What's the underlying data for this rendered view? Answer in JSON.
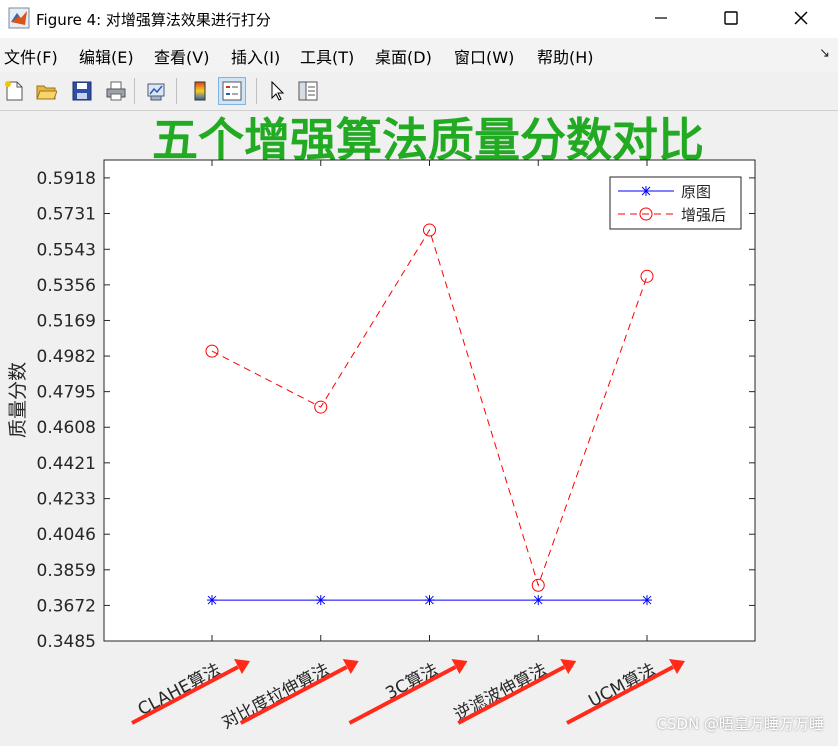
{
  "window": {
    "title": "Figure 4: 对增强算法效果进行打分",
    "minimize_icon": "minimize-icon",
    "maximize_icon": "maximize-icon",
    "close_icon": "close-icon"
  },
  "menu": [
    {
      "label": "文件(F)"
    },
    {
      "label": "编辑(E)"
    },
    {
      "label": "查看(V)"
    },
    {
      "label": "插入(I)"
    },
    {
      "label": "工具(T)"
    },
    {
      "label": "桌面(D)"
    },
    {
      "label": "窗口(W)"
    },
    {
      "label": "帮助(H)"
    }
  ],
  "toolbar": {
    "icons": [
      "new-file-icon",
      "open-folder-icon",
      "save-icon",
      "print-icon",
      "link-icon",
      "colorbar-icon",
      "legend-icon",
      "pointer-icon",
      "property-editor-icon"
    ]
  },
  "chart_data": {
    "type": "line",
    "title": "五个增强算法质量分数对比",
    "xlabel": "",
    "ylabel": "质量分数",
    "categories": [
      "CLAHE算法",
      "对比度拉伸算法",
      "3C算法",
      "逆滤波伸算法",
      "UCM算法"
    ],
    "yticks": [
      "0.3485",
      "0.3672",
      "0.3859",
      "0.4046",
      "0.4233",
      "0.4421",
      "0.4608",
      "0.4795",
      "0.4982",
      "0.5169",
      "0.5356",
      "0.5543",
      "0.5731",
      "0.5918"
    ],
    "ylim": [
      0.3485,
      0.6012
    ],
    "grid": false,
    "legend_position": "top-right",
    "series": [
      {
        "name": "原图",
        "values": [
          0.37,
          0.37,
          0.37,
          0.37,
          0.37
        ],
        "color": "#0000ff",
        "style": "solid",
        "marker": "asterisk"
      },
      {
        "name": "增强后",
        "values": [
          0.5008,
          0.4714,
          0.5644,
          0.3778,
          0.5401
        ],
        "color": "#ff0000",
        "style": "dashed",
        "marker": "circle"
      }
    ],
    "title_color": "#22aa22"
  },
  "watermark": "CSDN @晤皇万睡万万睡",
  "colors": {
    "annotation_arrow": "#ff2a1a"
  }
}
